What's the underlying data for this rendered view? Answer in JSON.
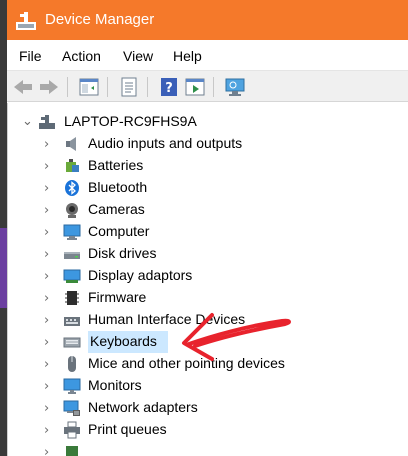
{
  "window": {
    "title": "Device Manager"
  },
  "menu": [
    "File",
    "Action",
    "View",
    "Help"
  ],
  "toolbar": {
    "buttons": [
      "back-icon",
      "forward-icon",
      "show-hide-console-tree-icon",
      "properties-icon",
      "help-icon",
      "run-action-icon",
      "scan-hardware-icon"
    ]
  },
  "tree": {
    "root": "LAPTOP-RC9FHS9A",
    "items": [
      {
        "label": "Audio inputs and outputs",
        "icon": "speaker-icon"
      },
      {
        "label": "Batteries",
        "icon": "battery-icon"
      },
      {
        "label": "Bluetooth",
        "icon": "bluetooth-icon"
      },
      {
        "label": "Cameras",
        "icon": "camera-icon"
      },
      {
        "label": "Computer",
        "icon": "computer-icon"
      },
      {
        "label": "Disk drives",
        "icon": "disk-drive-icon"
      },
      {
        "label": "Display adaptors",
        "icon": "display-adapter-icon"
      },
      {
        "label": "Firmware",
        "icon": "firmware-icon"
      },
      {
        "label": "Human Interface Devices",
        "icon": "hid-icon"
      },
      {
        "label": "Keyboards",
        "icon": "keyboard-icon"
      },
      {
        "label": "Mice and other pointing devices",
        "icon": "mouse-icon"
      },
      {
        "label": "Monitors",
        "icon": "monitor-icon"
      },
      {
        "label": "Network adapters",
        "icon": "network-adapter-icon"
      },
      {
        "label": "Print queues",
        "icon": "printer-icon"
      }
    ],
    "selected_index": 9
  },
  "colors": {
    "titlebar": "#f5792a",
    "selection": "#cce8ff",
    "annotation": "#e8232d"
  }
}
